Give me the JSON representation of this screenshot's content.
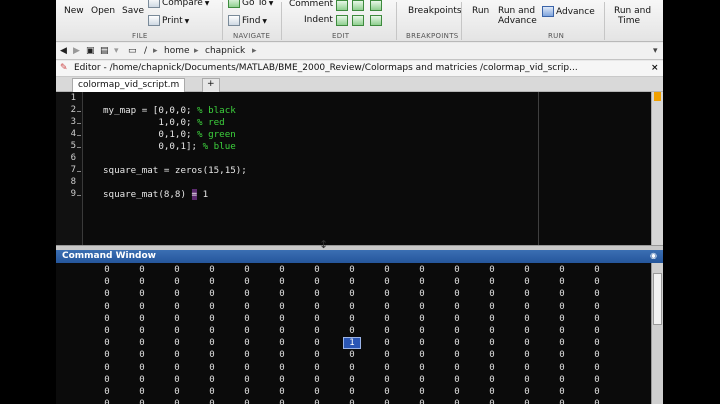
{
  "toolstrip": {
    "new": "New",
    "open": "Open",
    "save": "Save",
    "compare": "Compare",
    "print": "Print",
    "goto": "Go To",
    "find": "Find",
    "comment": "Comment",
    "indent": "Indent",
    "breakpoints": "Breakpoints",
    "run": "Run",
    "run_and_advance_1": "Run and",
    "run_and_advance_2": "Advance",
    "advance": "Advance",
    "run_and_time_1": "Run and",
    "run_and_time_2": "Time",
    "sections": [
      "FILE",
      "NAVIGATE",
      "EDIT",
      "BREAKPOINTS",
      "RUN"
    ]
  },
  "address": {
    "separator": "/",
    "parts": [
      "home",
      "chapnick"
    ]
  },
  "editor": {
    "title": "Editor - /home/chapnick/Documents/MATLAB/BME_2000_Review/Colormaps and matricies /colormap_vid_scrip...",
    "tab": "colormap_vid_script.m",
    "add_tab": "+",
    "line_numbers": [
      "1",
      "2",
      "3",
      "4",
      "5",
      "6",
      "7",
      "8",
      "9"
    ],
    "lines": [
      {
        "code": "",
        "comment": ""
      },
      {
        "code": "my_map = [0,0,0; ",
        "comment": "% black"
      },
      {
        "code": "          1,0,0; ",
        "comment": "% red"
      },
      {
        "code": "          0,1,0; ",
        "comment": "% green"
      },
      {
        "code": "          0,0,1]; ",
        "comment": "% blue"
      },
      {
        "code": "",
        "comment": ""
      },
      {
        "code": "square_mat = zeros(15,15);",
        "comment": ""
      },
      {
        "code": "",
        "comment": ""
      },
      {
        "code": "square_mat(8,8) ",
        "comment": ""
      }
    ],
    "line9_op": "=",
    "line9_val": " 1"
  },
  "command_window": {
    "title": "Command Window",
    "selected_value": "1",
    "zero": "0"
  },
  "colors": {
    "comment": "#3dd13d",
    "title_bar": "#25569c",
    "selection": "#2a56b5"
  }
}
